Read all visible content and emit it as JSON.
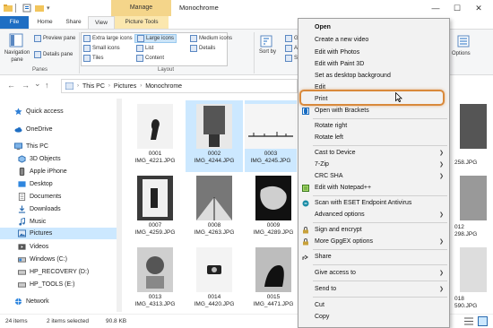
{
  "window": {
    "title": "Monochrome",
    "manage_tab": "Manage",
    "controls": {
      "minimize": "—",
      "maximize": "☐",
      "close": "✕"
    }
  },
  "ribbon_tabs": {
    "file": "File",
    "home": "Home",
    "share": "Share",
    "view": "View",
    "picture_tools": "Picture Tools"
  },
  "ribbon": {
    "navigation_pane": "Navigation pane",
    "preview_pane": "Preview pane",
    "details_pane": "Details pane",
    "panes_label": "Panes",
    "extra_large_icons": "Extra large icons",
    "large_icons": "Large icons",
    "medium_icons": "Medium icons",
    "small_icons": "Small icons",
    "list": "List",
    "details": "Details",
    "tiles": "Tiles",
    "content": "Content",
    "layout_label": "Layout",
    "sort_by": "Sort by",
    "gr": "Gr",
    "ad": "Ad",
    "siz": "Siz",
    "options": "Options"
  },
  "address": {
    "back": "←",
    "forward": "→",
    "recent": "⌄",
    "up": "↑",
    "crumbs": [
      "This PC",
      "Pictures",
      "Monochrome"
    ]
  },
  "sidebar": {
    "items": [
      {
        "label": "Quick access",
        "icon": "star-icon"
      },
      {
        "label": "OneDrive",
        "icon": "cloud-icon"
      },
      {
        "label": "This PC",
        "icon": "computer-icon"
      },
      {
        "label": "3D Objects",
        "icon": "cube-icon"
      },
      {
        "label": "Apple iPhone",
        "icon": "phone-icon"
      },
      {
        "label": "Desktop",
        "icon": "desktop-icon"
      },
      {
        "label": "Documents",
        "icon": "document-icon"
      },
      {
        "label": "Downloads",
        "icon": "download-icon"
      },
      {
        "label": "Music",
        "icon": "music-icon"
      },
      {
        "label": "Pictures",
        "icon": "pictures-icon"
      },
      {
        "label": "Videos",
        "icon": "video-icon"
      },
      {
        "label": "Windows (C:)",
        "icon": "drive-icon"
      },
      {
        "label": "HP_RECOVERY (D:)",
        "icon": "drive-icon"
      },
      {
        "label": "HP_TOOLS (E:)",
        "icon": "drive-icon"
      },
      {
        "label": "Network",
        "icon": "network-icon"
      }
    ]
  },
  "files": [
    {
      "num": "0001",
      "name": "IMG_4221.JPG",
      "selected": false
    },
    {
      "num": "0002",
      "name": "IMG_4244.JPG",
      "selected": true
    },
    {
      "num": "0003",
      "name": "IMG_4245.JPG",
      "selected": true
    },
    {
      "num": "0007",
      "name": "IMG_4259.JPG",
      "selected": false
    },
    {
      "num": "0008",
      "name": "IMG_4263.JPG",
      "selected": false
    },
    {
      "num": "0009",
      "name": "IMG_4289.JPG",
      "selected": false
    },
    {
      "num": "0013",
      "name": "IMG_4313.JPG",
      "selected": false
    },
    {
      "num": "0014",
      "name": "IMG_4420.JPG",
      "selected": false
    },
    {
      "num": "0015",
      "name": "IMG_4471.JPG",
      "selected": false
    }
  ],
  "right_partial": {
    "r1": "258.JPG",
    "r2a": "012",
    "r2b": "298.JPG",
    "r3a": "018",
    "r3b": "590.JPG"
  },
  "status": {
    "items": "24 items",
    "selected": "2 items selected",
    "size": "90.8 KB"
  },
  "context_menu": {
    "items": [
      {
        "label": "Open",
        "bold": true,
        "icon": ""
      },
      {
        "label": "Create a new video",
        "icon": ""
      },
      {
        "label": "Edit with Photos",
        "icon": ""
      },
      {
        "label": "Edit with Paint 3D",
        "icon": ""
      },
      {
        "label": "Set as desktop background",
        "icon": ""
      },
      {
        "label": "Edit",
        "icon": ""
      },
      {
        "label": "Print",
        "icon": ""
      },
      {
        "label": "Open with Brackets",
        "icon": "brackets-icon"
      },
      {
        "label": "Rotate right",
        "icon": ""
      },
      {
        "label": "Rotate left",
        "icon": ""
      },
      {
        "label": "Cast to Device",
        "icon": "",
        "submenu": true
      },
      {
        "label": "7-Zip",
        "icon": "",
        "submenu": true
      },
      {
        "label": "CRC SHA",
        "icon": "",
        "submenu": true
      },
      {
        "label": "Edit with Notepad++",
        "icon": "notepad-icon"
      },
      {
        "label": "Scan with ESET Endpoint Antivirus",
        "icon": "eset-icon"
      },
      {
        "label": "Advanced options",
        "icon": "",
        "submenu": true
      },
      {
        "label": "Sign and encrypt",
        "icon": "lock-icon"
      },
      {
        "label": "More GpgEX options",
        "icon": "lock-icon",
        "submenu": true
      },
      {
        "label": "Share",
        "icon": "share-icon"
      },
      {
        "label": "Give access to",
        "icon": "",
        "submenu": true
      },
      {
        "label": "Send to",
        "icon": "",
        "submenu": true
      },
      {
        "label": "Cut",
        "icon": ""
      },
      {
        "label": "Copy",
        "icon": ""
      }
    ]
  },
  "colors": {
    "accent": "#1f6ec3",
    "selection": "#cce8ff",
    "manage": "#f4d58a",
    "highlight": "#d9893b"
  }
}
